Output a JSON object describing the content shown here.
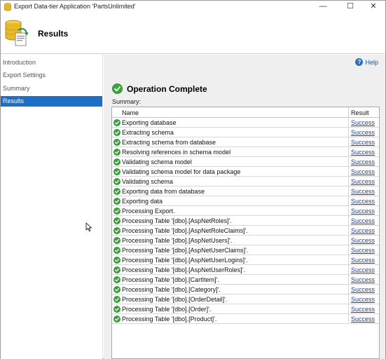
{
  "window": {
    "title": "Export Data-tier Application 'PartsUnlimited'",
    "minimize_glyph": "—",
    "maximize_glyph": "☐",
    "close_glyph": "✕"
  },
  "banner": {
    "page_title": "Results",
    "icon": "database-export-icon"
  },
  "sidebar": {
    "items": [
      {
        "label": "Introduction",
        "active": false
      },
      {
        "label": "Export Settings",
        "active": false
      },
      {
        "label": "Summary",
        "active": false
      },
      {
        "label": "Results",
        "active": true
      }
    ]
  },
  "content": {
    "help_label": "Help",
    "help_glyph": "?",
    "operation_title": "Operation Complete",
    "summary_label": "Summary:",
    "columns": {
      "name": "Name",
      "result": "Result"
    },
    "rows": [
      {
        "name": "Exporting database",
        "result": "Success"
      },
      {
        "name": "Extracting schema",
        "result": "Success"
      },
      {
        "name": "Extracting schema from database",
        "result": "Success"
      },
      {
        "name": "Resolving references in schema model",
        "result": "Success"
      },
      {
        "name": "Validating schema model",
        "result": "Success"
      },
      {
        "name": "Validating schema model for data package",
        "result": "Success"
      },
      {
        "name": "Validating schema",
        "result": "Success"
      },
      {
        "name": "Exporting data from database",
        "result": "Success"
      },
      {
        "name": "Exporting data",
        "result": "Success"
      },
      {
        "name": "Processing Export.",
        "result": "Success"
      },
      {
        "name": "Processing Table '[dbo].[AspNetRoles]'.",
        "result": "Success"
      },
      {
        "name": "Processing Table '[dbo].[AspNetRoleClaims]'.",
        "result": "Success"
      },
      {
        "name": "Processing Table '[dbo].[AspNetUsers]'.",
        "result": "Success"
      },
      {
        "name": "Processing Table '[dbo].[AspNetUserClaims]'.",
        "result": "Success"
      },
      {
        "name": "Processing Table '[dbo].[AspNetUserLogins]'.",
        "result": "Success"
      },
      {
        "name": "Processing Table '[dbo].[AspNetUserRoles]'.",
        "result": "Success"
      },
      {
        "name": "Processing Table '[dbo].[CartItem]'.",
        "result": "Success"
      },
      {
        "name": "Processing Table '[dbo].[Category]'.",
        "result": "Success"
      },
      {
        "name": "Processing Table '[dbo].[OrderDetail]'.",
        "result": "Success"
      },
      {
        "name": "Processing Table '[dbo].[Order]'.",
        "result": "Success"
      },
      {
        "name": "Processing Table '[dbo].[Product]'.",
        "result": "Success"
      }
    ]
  },
  "colors": {
    "accent": "#1c6ec6",
    "success_green": "#3aa63a",
    "link": "#1a3fa8"
  }
}
